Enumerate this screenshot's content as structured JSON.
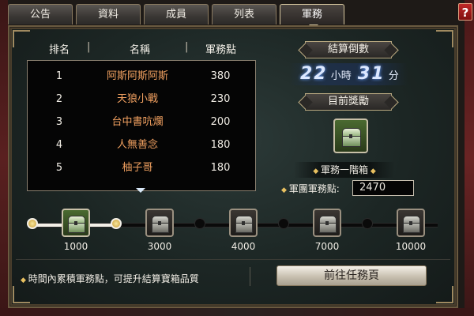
{
  "tabs": [
    {
      "label": "公告"
    },
    {
      "label": "資料"
    },
    {
      "label": "成員"
    },
    {
      "label": "列表"
    },
    {
      "label": "軍務",
      "active": true
    }
  ],
  "help_label": "?",
  "ranking": {
    "headers": {
      "rank": "排名",
      "name": "名稱",
      "points": "軍務點"
    },
    "rows": [
      {
        "rank": "1",
        "name": "阿斯阿斯阿斯",
        "points": "380"
      },
      {
        "rank": "2",
        "name": "天狼小戰",
        "points": "230"
      },
      {
        "rank": "3",
        "name": "台中書吭爛",
        "points": "200"
      },
      {
        "rank": "4",
        "name": "人無善念",
        "points": "180"
      },
      {
        "rank": "5",
        "name": "柚子哥",
        "points": "180"
      }
    ]
  },
  "countdown": {
    "title": "結算倒數",
    "hours": "22",
    "hours_unit": "小時",
    "minutes": "31",
    "minutes_unit": "分"
  },
  "reward": {
    "title": "目前獎勵",
    "icon": "treasure-chest-green",
    "name": "軍務一階箱",
    "points_label": "軍團軍務點:",
    "points_value": "2470"
  },
  "milestones": [
    {
      "label": "1000",
      "tier": "green",
      "reached": true
    },
    {
      "label": "3000",
      "tier": "gray",
      "reached": false
    },
    {
      "label": "4000",
      "tier": "gray",
      "reached": false
    },
    {
      "label": "7000",
      "tier": "gray",
      "reached": false
    },
    {
      "label": "10000",
      "tier": "gray",
      "reached": false
    }
  ],
  "hint": "時間內累積軍務點，可提升結算寶箱品質",
  "go_button": "前往任務頁",
  "colors": {
    "accent_gold": "#b8a880",
    "name_orange": "#f0a060",
    "panel_teal": "#1c2624"
  }
}
